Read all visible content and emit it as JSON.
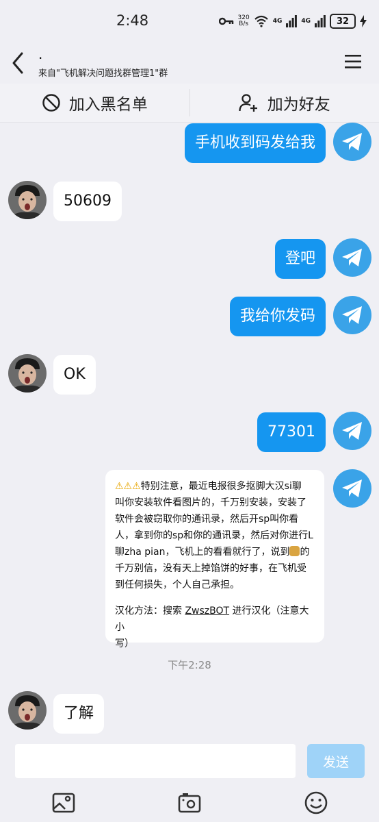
{
  "status_bar": {
    "time": "2:48",
    "net_speed_value": "320",
    "net_speed_unit": "B/s",
    "signal_label_1": "4G",
    "signal_label_2": "4G",
    "battery": "32"
  },
  "header": {
    "title": ".",
    "subtitle": "来自\"飞机解决问题找群管理1\"群"
  },
  "actions": {
    "block_label": "加入黑名单",
    "add_friend_label": "加为好友"
  },
  "messages": [
    {
      "side": "right",
      "text": "手机收到码发给我"
    },
    {
      "side": "left",
      "text": "50609"
    },
    {
      "side": "right",
      "text": "登吧"
    },
    {
      "side": "right",
      "text": "我给你发码"
    },
    {
      "side": "left",
      "text": "OK"
    },
    {
      "side": "right",
      "text": "77301"
    },
    {
      "side": "left",
      "text": "了解"
    }
  ],
  "notice": {
    "warn_emojis": "⚠⚠⚠",
    "line1": "特别注意，最近电报很多抠脚大汉si聊",
    "line2": "叫你安装软件看图片的，千万别安装，安装了",
    "line3": "软件会被窃取你的通讯录，然后开sp叫你看",
    "line4": "人，拿到你的sp和你的通讯录，然后对你进行L",
    "line5_before": "聊zha pian，飞机上的看看就行了，说到",
    "line5_after": "的",
    "line6": "千万别信，没有天上掉馅饼的好事，在飞机受",
    "line7": "到任何损失，个人自己承担。",
    "line8_before": "汉化方法：搜索 ",
    "bot_name": "ZwszBOT",
    "line8_after": " 进行汉化（注意大小",
    "line9": "写）"
  },
  "timestamp": "下午2:28",
  "input": {
    "placeholder": "",
    "send_label": "发送"
  },
  "colors": {
    "bubble_blue": "#1596f0",
    "send_disabled": "#9fd3f8",
    "telegram_blue": "#3aa3e8"
  }
}
